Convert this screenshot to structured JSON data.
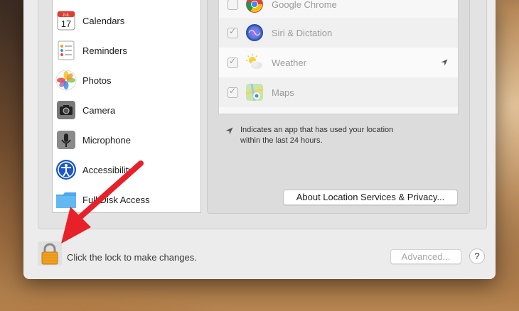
{
  "sidebar": {
    "items": [
      {
        "label": "Calendars",
        "icon": "calendar-icon",
        "calendar_month": "JUL",
        "calendar_day": "17"
      },
      {
        "label": "Reminders",
        "icon": "reminders-icon"
      },
      {
        "label": "Photos",
        "icon": "photos-icon"
      },
      {
        "label": "Camera",
        "icon": "camera-icon"
      },
      {
        "label": "Microphone",
        "icon": "microphone-icon"
      },
      {
        "label": "Accessibility",
        "icon": "accessibility-icon"
      },
      {
        "label": "Full Disk Access",
        "icon": "folder-icon"
      }
    ]
  },
  "apps": {
    "rows": [
      {
        "label": "Google Chrome",
        "checked": false,
        "icon": "chrome-icon",
        "recent_location": false
      },
      {
        "label": "Siri & Dictation",
        "checked": true,
        "icon": "siri-icon",
        "recent_location": false
      },
      {
        "label": "Weather",
        "checked": true,
        "icon": "weather-icon",
        "recent_location": true
      },
      {
        "label": "Maps",
        "checked": true,
        "icon": "maps-icon",
        "recent_location": false
      }
    ]
  },
  "note": {
    "text": "Indicates an app that has used your location within the last 24 hours.",
    "icon": "location-arrow-icon"
  },
  "about_button": {
    "label": "About Location Services & Privacy..."
  },
  "footer": {
    "lock_text": "Click the lock to make changes.",
    "lock_icon": "lock-icon",
    "advanced_label": "Advanced...",
    "help_label": "?"
  },
  "colors": {
    "arrow": "#e8202a",
    "lock": "#f0a020"
  }
}
